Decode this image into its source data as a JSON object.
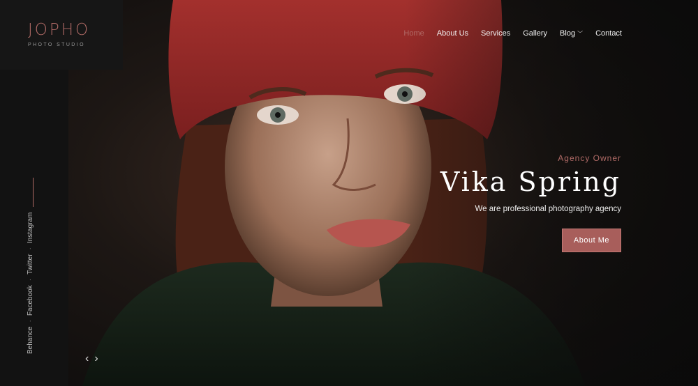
{
  "logo": {
    "name": "JOPHO",
    "tagline": "PHOTO STUDIO"
  },
  "nav": {
    "items": [
      {
        "label": "Home",
        "active": true
      },
      {
        "label": "About Us",
        "active": false
      },
      {
        "label": "Services",
        "active": false
      },
      {
        "label": "Gallery",
        "active": false
      },
      {
        "label": "Blog",
        "active": false,
        "has_dropdown": true
      },
      {
        "label": "Contact",
        "active": false
      }
    ]
  },
  "social": {
    "links": [
      "Behance",
      "Facebook",
      "Twitter",
      "Instagram"
    ],
    "separator": "·"
  },
  "hero": {
    "subtitle": "Agency Owner",
    "title": "Vika Spring",
    "description": "We are professional photography agency",
    "button_label": "About Me"
  },
  "slider": {
    "prev_icon": "‹",
    "next_icon": "›"
  },
  "colors": {
    "accent": "#b06a66",
    "button": "#a85e5b",
    "background": "#121212"
  }
}
